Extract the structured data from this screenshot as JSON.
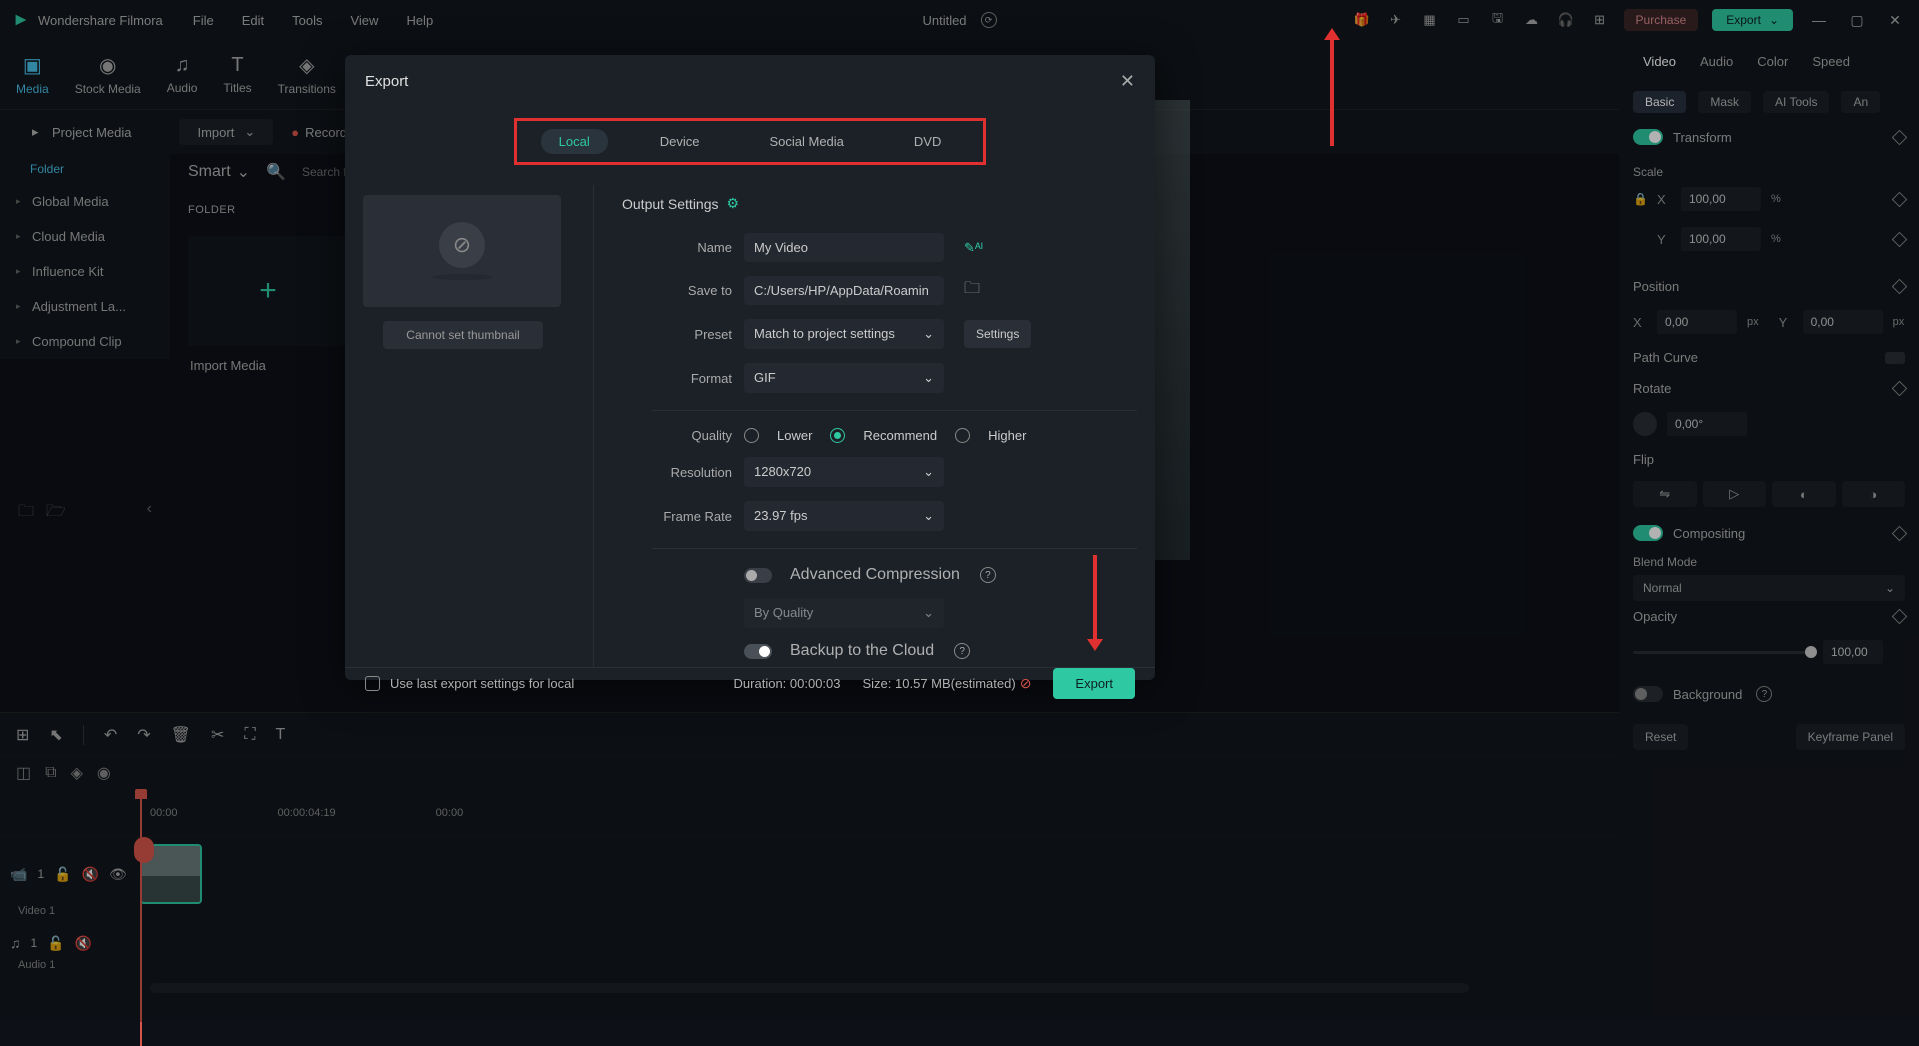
{
  "app": {
    "name": "Wondershare Filmora",
    "document": "Untitled"
  },
  "menu": {
    "file": "File",
    "edit": "Edit",
    "tools": "Tools",
    "view": "View",
    "help": "Help"
  },
  "top_buttons": {
    "purchase": "Purchase",
    "export": "Export"
  },
  "main_tabs": {
    "media": "Media",
    "stock": "Stock Media",
    "audio": "Audio",
    "titles": "Titles",
    "transitions": "Transitions"
  },
  "sec": {
    "import": "Import",
    "record": "Record",
    "smart": "Smart",
    "search_placeholder": "Search file"
  },
  "sidebar": {
    "project": "Project Media",
    "folder": "Folder",
    "global": "Global Media",
    "cloud": "Cloud Media",
    "influence": "Influence Kit",
    "adjust": "Adjustment La...",
    "compound": "Compound Clip"
  },
  "media_panel": {
    "folder_hdr": "FOLDER",
    "import_label": "Import Media"
  },
  "right": {
    "tabs": {
      "video": "Video",
      "audio": "Audio",
      "color": "Color",
      "speed": "Speed"
    },
    "subtabs": {
      "basic": "Basic",
      "mask": "Mask",
      "ai": "AI Tools",
      "anim": "An"
    },
    "transform": "Transform",
    "scale": "Scale",
    "scale_x": "100,00",
    "scale_y": "100,00",
    "position": "Position",
    "pos_x": "0,00",
    "pos_y": "0,00",
    "path": "Path Curve",
    "rotate": "Rotate",
    "rotate_val": "0,00°",
    "flip": "Flip",
    "compositing": "Compositing",
    "blend": "Blend Mode",
    "blend_val": "Normal",
    "opacity": "Opacity",
    "opacity_val": "100,00",
    "background": "Background",
    "reset": "Reset",
    "keyframe": "Keyframe Panel"
  },
  "timeline": {
    "marks": [
      "00:00",
      "00:00:04:19",
      "00:00"
    ],
    "track_v": "Video 1",
    "track_a": "Audio 1",
    "v_num": "1",
    "a_num": "1"
  },
  "modal": {
    "title": "Export",
    "tabs": {
      "local": "Local",
      "device": "Device",
      "social": "Social Media",
      "dvd": "DVD"
    },
    "cannot_set": "Cannot set thumbnail",
    "output_settings": "Output Settings",
    "name_lbl": "Name",
    "name_val": "My Video",
    "save_lbl": "Save to",
    "save_val": "C:/Users/HP/AppData/Roamin",
    "preset_lbl": "Preset",
    "preset_val": "Match to project settings",
    "settings_btn": "Settings",
    "format_lbl": "Format",
    "format_val": "GIF",
    "quality_lbl": "Quality",
    "q_lower": "Lower",
    "q_rec": "Recommend",
    "q_higher": "Higher",
    "res_lbl": "Resolution",
    "res_val": "1280x720",
    "fps_lbl": "Frame Rate",
    "fps_val": "23.97 fps",
    "adv_comp": "Advanced Compression",
    "by_quality": "By Quality",
    "backup": "Backup to the Cloud",
    "use_last": "Use last export settings for local",
    "duration": "Duration: 00:00:03",
    "size": "Size: 10.57 MB(estimated)",
    "export_btn": "Export"
  }
}
